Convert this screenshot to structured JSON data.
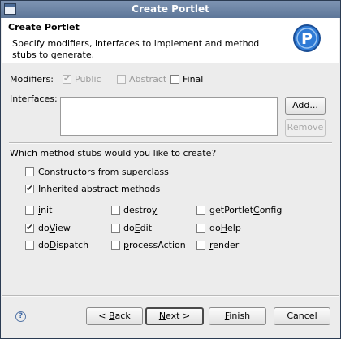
{
  "window": {
    "title": "Create Portlet"
  },
  "banner": {
    "title": "Create Portlet",
    "description": "Specify modifiers, interfaces to implement and method stubs to generate.",
    "logo_letter": "P"
  },
  "modifiers": {
    "label": "Modifiers:",
    "public": {
      "label": "Public",
      "checked": true,
      "enabled": false
    },
    "abstract": {
      "label": "Abstract",
      "checked": false,
      "enabled": false
    },
    "final": {
      "label": "Final",
      "checked": false,
      "enabled": true
    }
  },
  "interfaces": {
    "label": "Interfaces:",
    "add_label": "Add...",
    "remove_label": "Remove"
  },
  "stubs": {
    "question": "Which method stubs would you like to create?",
    "constructors": {
      "label": "Constructors from superclass",
      "checked": false
    },
    "inherited": {
      "label": "Inherited abstract methods",
      "checked": true
    },
    "methods": [
      {
        "pre": "",
        "u": "i",
        "post": "nit",
        "checked": false
      },
      {
        "pre": "destro",
        "u": "y",
        "post": "",
        "checked": false
      },
      {
        "pre": "getPortlet",
        "u": "C",
        "post": "onfig",
        "checked": false
      },
      {
        "pre": "do",
        "u": "V",
        "post": "iew",
        "checked": true
      },
      {
        "pre": "do",
        "u": "E",
        "post": "dit",
        "checked": false
      },
      {
        "pre": "do",
        "u": "H",
        "post": "elp",
        "checked": false
      },
      {
        "pre": "do",
        "u": "D",
        "post": "ispatch",
        "checked": false
      },
      {
        "pre": "",
        "u": "p",
        "post": "rocessAction",
        "checked": false
      },
      {
        "pre": "",
        "u": "r",
        "post": "ender",
        "checked": false
      }
    ]
  },
  "footer": {
    "help_glyph": "?",
    "back": {
      "pre": "< ",
      "u": "B",
      "post": "ack"
    },
    "next": {
      "pre": "",
      "u": "N",
      "post": "ext >"
    },
    "finish": {
      "pre": "",
      "u": "F",
      "post": "inish"
    },
    "cancel": {
      "label": "Cancel"
    }
  },
  "colors": {
    "title_bar": "#5d7698",
    "logo": "#2f7bd6"
  }
}
